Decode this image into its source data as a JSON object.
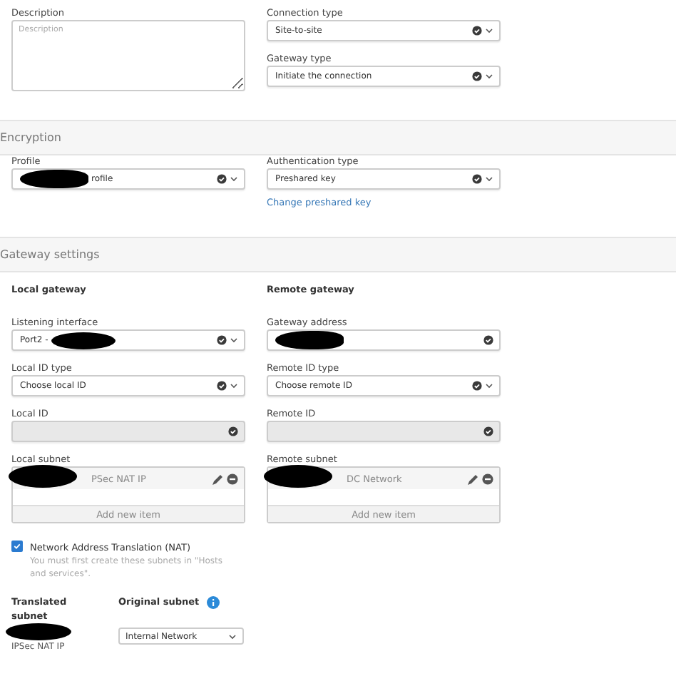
{
  "general": {
    "description": {
      "label": "Description",
      "placeholder": "Description"
    },
    "connection_type": {
      "label": "Connection type",
      "value": "Site-to-site",
      "kind": "select"
    },
    "gateway_type": {
      "label": "Gateway type",
      "value": "Initiate the connection",
      "kind": "select"
    }
  },
  "encryption": {
    "title": "Encryption",
    "profile": {
      "label": "Profile",
      "value": "rofile",
      "kind": "select",
      "redacted": true,
      "redacted_start": true
    },
    "authentication_type": {
      "label": "Authentication type",
      "value": "Preshared key",
      "kind": "select"
    },
    "link": "Change preshared key"
  },
  "gateway_settings": {
    "title": "Gateway settings",
    "local": {
      "heading": "Local gateway",
      "fields": [
        {
          "label": "Listening interface",
          "value": "Port2 -",
          "kind": "select",
          "redacted": true,
          "redacted_start": false
        },
        {
          "label": "Local ID type",
          "value": "Choose local ID",
          "kind": "select"
        },
        {
          "label": "Local ID",
          "kind": "text",
          "disabled": true
        }
      ],
      "subnet": {
        "label": "Local subnet",
        "items": [
          {
            "text": "PSec NAT IP",
            "redacted": true
          }
        ],
        "add_button": "Add new item"
      }
    },
    "remote": {
      "heading": "Remote gateway",
      "fields": [
        {
          "label": "Gateway address",
          "kind": "text",
          "redacted": true,
          "redacted_start": true
        },
        {
          "label": "Remote ID type",
          "value": "Choose remote ID",
          "kind": "select"
        },
        {
          "label": "Remote ID",
          "kind": "text",
          "disabled": true
        }
      ],
      "subnet": {
        "label": "Remote subnet",
        "items": [
          {
            "text": "DC Network",
            "redacted": true
          }
        ],
        "add_button": "Add new item"
      }
    },
    "nat": {
      "label": "Network Address Translation (NAT)",
      "checked": true,
      "help": "You must first create these subnets in \"Hosts and services\"."
    },
    "translated_subnet": {
      "label": "Translated subnet",
      "value": "IPSec NAT IP",
      "redacted": true
    },
    "original_subnet": {
      "label": "Original subnet",
      "value": "Internal Network"
    }
  }
}
